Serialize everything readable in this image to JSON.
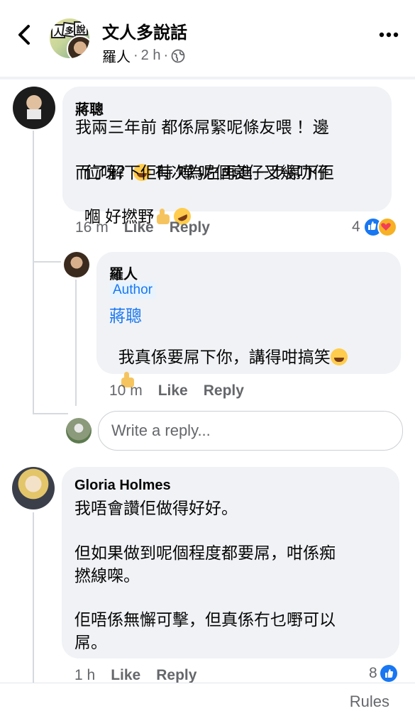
{
  "header": {
    "title": "文人多說話",
    "author": "羅人",
    "time": "2 h",
    "dot": "·",
    "back_icon": "chevron-left-icon",
    "more_icon": "more-horizontal-icon",
    "privacy_icon": "globe-icon"
  },
  "comments": [
    {
      "name": "蔣聰",
      "lines": [
        "我兩三年前 都係屌緊呢條友喂 ！邊",
        "位呀？",
        " 有次為左再進一步屌下佢",
        "而了解下佢時 嘩 呢個衰仔又幾叻仔",
        "嗰 好撚野"
      ],
      "time": "16 m",
      "like": "Like",
      "reply": "Reply",
      "reactions_count": "4"
    },
    {
      "name": "羅人",
      "author_tag": "Author",
      "mention": "蔣聰",
      "lines": [
        "我真係要屌下你，講得咁搞笑"
      ],
      "time": "10 m",
      "like": "Like",
      "reply": "Reply"
    },
    {
      "name": "Gloria Holmes",
      "lines": [
        "我唔會讚佢做得好好。",
        "",
        "但如果做到呢個程度都要屌，咁係痴",
        "撚線㗎。",
        "",
        "佢唔係無懈可擊，但真係冇乜嘢可以",
        "屌。"
      ],
      "time": "1 h",
      "like": "Like",
      "reply": "Reply",
      "reactions_count": "8"
    }
  ],
  "reply_input": {
    "placeholder": "Write a reply..."
  },
  "footer": {
    "rules": "Rules"
  },
  "colors": {
    "link": "#1877f2",
    "bubble": "#f0f2f5",
    "secondary": "#65676b",
    "like": "#1877f2",
    "love": "#f33e58",
    "haha": "#f7b125"
  }
}
